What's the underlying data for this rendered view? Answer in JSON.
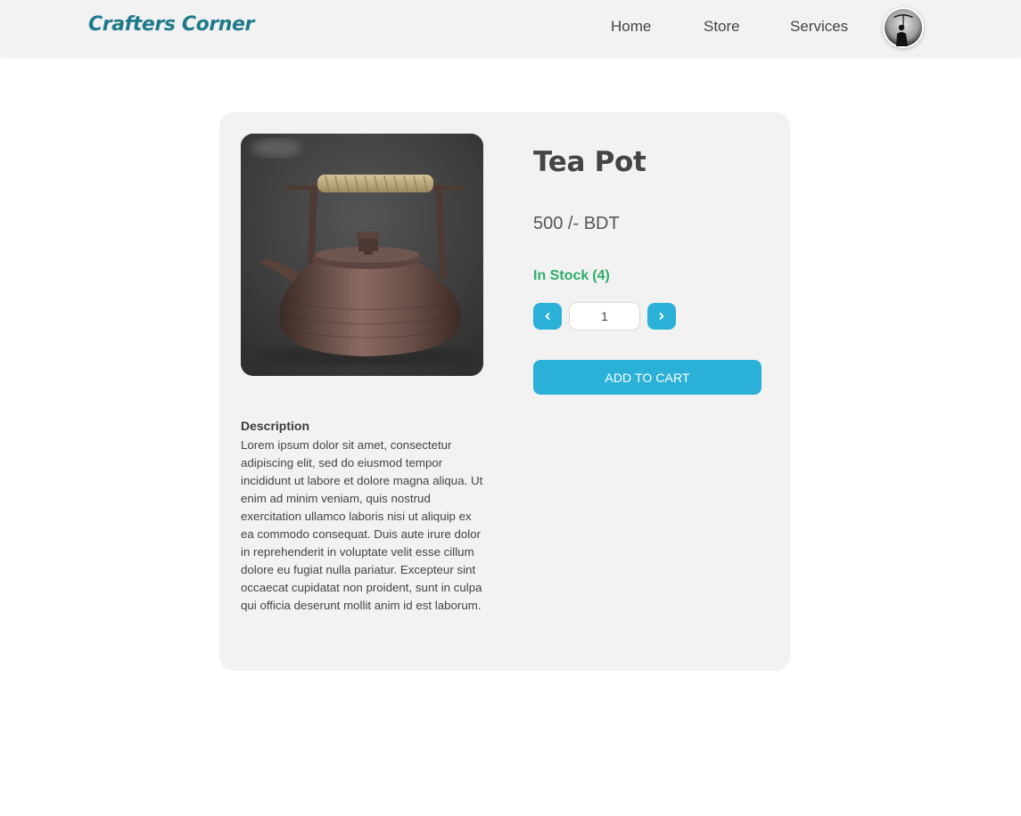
{
  "header": {
    "brand": "Crafters Corner",
    "nav": [
      {
        "label": "Home"
      },
      {
        "label": "Store"
      },
      {
        "label": "Services"
      }
    ],
    "avatar_icon": "user-avatar-icon"
  },
  "product": {
    "title": "Tea Pot",
    "price": "500 /- BDT",
    "stock_label": "In Stock",
    "stock_count": "(4)",
    "quantity": "1",
    "decrement_icon": "chevron-left-icon",
    "increment_icon": "chevron-right-icon",
    "add_to_cart_label": "ADD TO CART",
    "description_heading": "Description",
    "description": "Lorem ipsum dolor sit amet, consectetur adipiscing elit, sed do eiusmod tempor incididunt ut labore et dolore magna aliqua. Ut enim ad minim veniam, quis nostrud exercitation ullamco laboris nisi ut aliquip ex ea commodo consequat. Duis aute irure dolor in reprehenderit in voluptate velit esse cillum dolore eu fugiat nulla pariatur. Excepteur sint occaecat cupidatat non proident, sunt in culpa qui officia deserunt mollit anim id est laborum."
  },
  "colors": {
    "brand": "#1f7a8c",
    "accent": "#2bb1d8",
    "in_stock": "#2fae6b",
    "card_bg": "#f2f2f2",
    "header_bg": "#f2f2f2"
  }
}
